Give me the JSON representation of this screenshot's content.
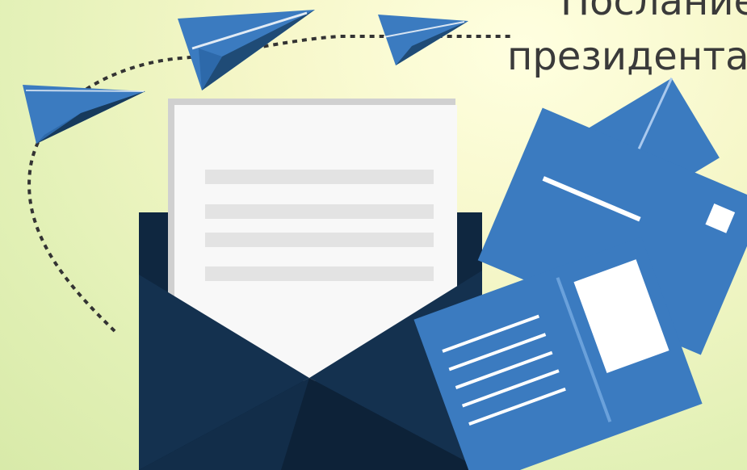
{
  "heading": {
    "line1": "Послание",
    "line2": "президента"
  },
  "colors": {
    "background_top": "#ffffe0",
    "background_bottom": "#d8eaa9",
    "envelope_dark": "#0f2740",
    "envelope_mid": "#163a5c",
    "mail_blue": "#3b7bc0",
    "paper": "#f8f8f8",
    "paper_shadow": "#c8c8c8",
    "text_line": "#e2e2e2",
    "dash": "#333333"
  },
  "icons": {
    "plane": "paper-plane-icon",
    "envelope": "open-envelope-icon",
    "letter": "letter-icon",
    "mail_stack": "mail-stack-icon"
  }
}
